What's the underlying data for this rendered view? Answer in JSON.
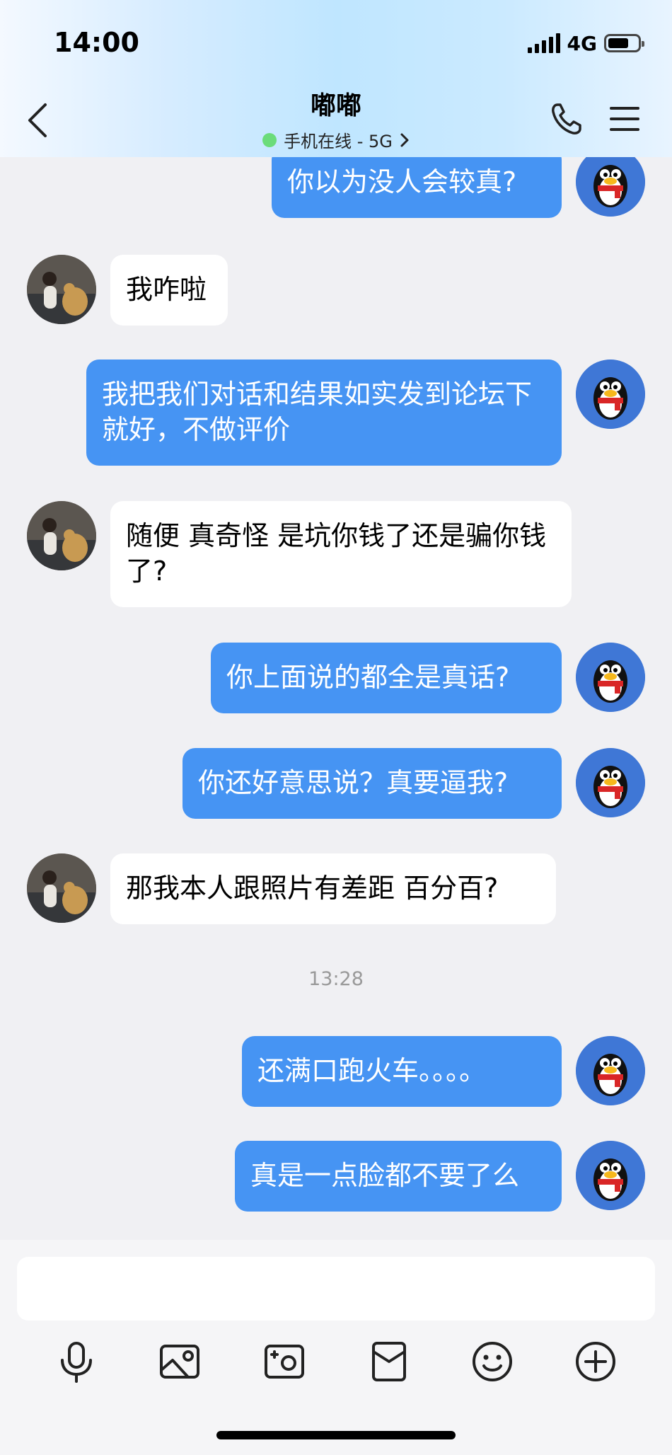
{
  "status_bar": {
    "time": "14:00",
    "network": "4G"
  },
  "header": {
    "title": "嘟嘟",
    "subtitle": "手机在线 - 5G"
  },
  "messages": [
    {
      "from": "me",
      "text": "你以为没人会较真?"
    },
    {
      "from": "her",
      "text": "我咋啦"
    },
    {
      "from": "me",
      "text": "我把我们对话和结果如实发到论坛下就好，不做评价"
    },
    {
      "from": "her",
      "text": "随便 真奇怪 是坑你钱了还是骗你钱了?"
    },
    {
      "from": "me",
      "text": "你上面说的都全是真话?"
    },
    {
      "from": "me",
      "text": "你还好意思说？真要逼我?"
    },
    {
      "from": "her",
      "text": "那我本人跟照片有差距 百分百?"
    },
    {
      "from": "me",
      "text": "还满口跑火车。。。。"
    },
    {
      "from": "me",
      "text": "真是一点脸都不要了么"
    }
  ],
  "timestamp": "13:28",
  "input": {
    "placeholder": ""
  },
  "toolbar": [
    "microphone-icon",
    "image-icon",
    "camera-icon",
    "red-packet-icon",
    "emoji-icon",
    "plus-icon"
  ],
  "colors": {
    "my_bubble": "#4694f3",
    "her_bubble": "#ffffff",
    "background": "#f0f0f3",
    "online": "#6bdc7a"
  }
}
